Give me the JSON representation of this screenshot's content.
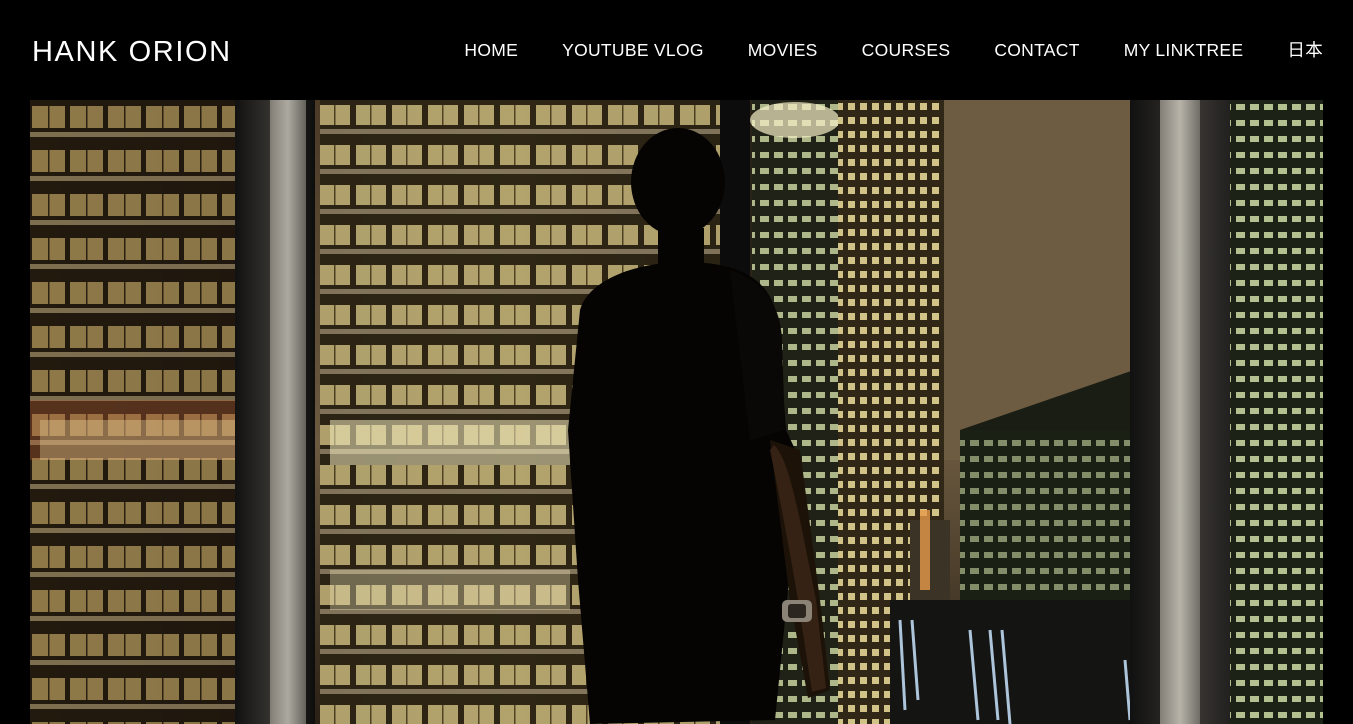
{
  "header": {
    "site_title": "HANK ORION",
    "nav": [
      {
        "label": "HOME",
        "name": "nav-home"
      },
      {
        "label": "YOUTUBE VLOG",
        "name": "nav-youtube-vlog"
      },
      {
        "label": "MOVIES",
        "name": "nav-movies"
      },
      {
        "label": "COURSES",
        "name": "nav-courses"
      },
      {
        "label": "CONTACT",
        "name": "nav-contact"
      },
      {
        "label": "MY LINKTREE",
        "name": "nav-my-linktree"
      },
      {
        "label": "日本",
        "name": "nav-japanese"
      }
    ]
  },
  "hero": {
    "image": "night-city-window-silhouette"
  },
  "colors": {
    "background": "#000000",
    "text": "#ffffff",
    "window_light": "#f3e6a8",
    "dark_structure": "#1a120a"
  }
}
